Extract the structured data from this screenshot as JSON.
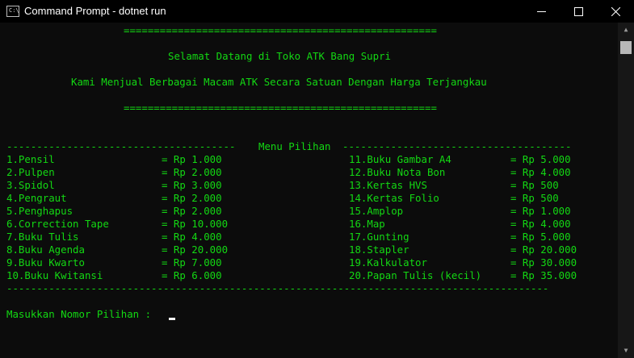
{
  "window": {
    "title": "Command Prompt - dotnet  run",
    "icon": "cmd-icon",
    "controls": [
      "minimize-icon",
      "maximize-icon",
      "close-icon"
    ]
  },
  "colors": {
    "background": "#0c0c0c",
    "text": "#13d813",
    "titlebar": "#000000",
    "cursor": "#f2f2f2"
  },
  "terminal": {
    "rule_top": "====================================================",
    "welcome": "Selamat Datang di Toko ATK Bang Supri",
    "tagline": "Kami Menjual Berbagai Macam ATK Secara Satuan Dengan Harga Terjangkau",
    "rule_bottom": "====================================================",
    "menu_header_left": "--------------------------------------",
    "menu_title": "Menu Pilihan",
    "menu_header_right": "--------------------------------------",
    "menu_left": [
      {
        "item": "1.Pensil",
        "price": "= Rp 1.000"
      },
      {
        "item": "2.Pulpen",
        "price": "= Rp 2.000"
      },
      {
        "item": "3.Spidol",
        "price": "= Rp 3.000"
      },
      {
        "item": "4.Pengraut",
        "price": "= Rp 2.000"
      },
      {
        "item": "5.Penghapus",
        "price": "= Rp 2.000"
      },
      {
        "item": "6.Correction Tape",
        "price": "= Rp 10.000"
      },
      {
        "item": "7.Buku Tulis",
        "price": "= Rp 4.000"
      },
      {
        "item": "8.Buku Agenda",
        "price": "= Rp 20.000"
      },
      {
        "item": "9.Buku Kwarto",
        "price": "= Rp 7.000"
      },
      {
        "item": "10.Buku Kwitansi",
        "price": "= Rp 6.000"
      }
    ],
    "menu_right": [
      {
        "item": "11.Buku Gambar A4",
        "price": "= Rp 5.000"
      },
      {
        "item": "12.Buku Nota Bon",
        "price": "= Rp 4.000"
      },
      {
        "item": "13.Kertas HVS",
        "price": "= Rp 500"
      },
      {
        "item": "14.Kertas Folio",
        "price": "= Rp 500"
      },
      {
        "item": "15.Amplop",
        "price": "= Rp 1.000"
      },
      {
        "item": "16.Map",
        "price": "= Rp 4.000"
      },
      {
        "item": "17.Gunting",
        "price": "= Rp 5.000"
      },
      {
        "item": "18.Stapler",
        "price": "= Rp 20.000"
      },
      {
        "item": "19.Kalkulator",
        "price": "= Rp 30.000"
      },
      {
        "item": "20.Papan Tulis (kecil)",
        "price": "= Rp 35.000"
      }
    ],
    "menu_footer": "------------------------------------------------------------------------------------------",
    "prompt": "Masukkan Nomor Pilihan : "
  }
}
